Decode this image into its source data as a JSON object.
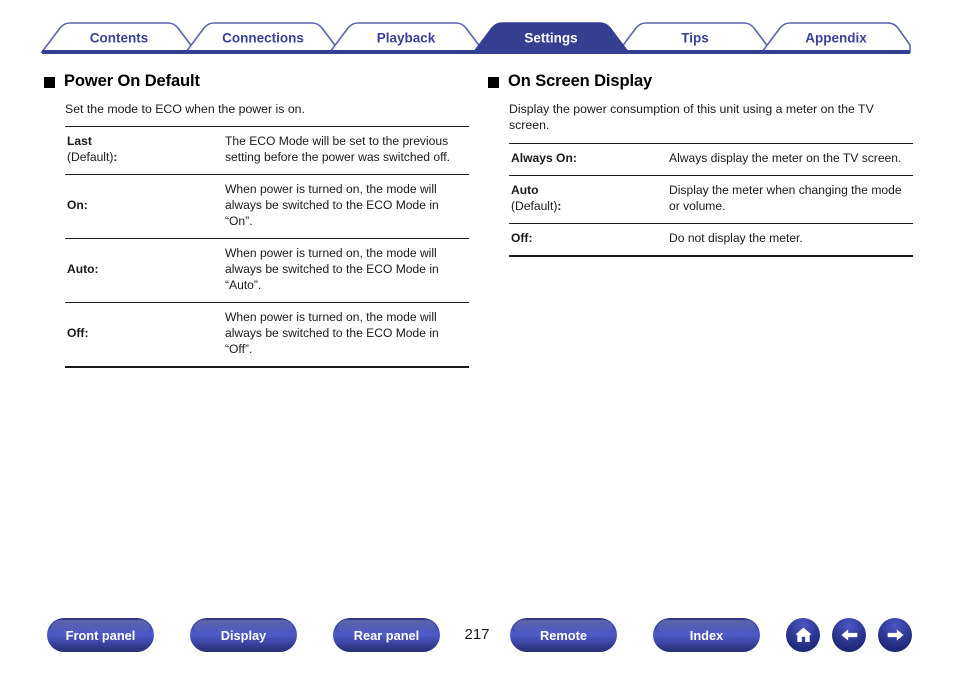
{
  "tabs": [
    {
      "label": "Contents",
      "active": false
    },
    {
      "label": "Connections",
      "active": false
    },
    {
      "label": "Playback",
      "active": false
    },
    {
      "label": "Settings",
      "active": true
    },
    {
      "label": "Tips",
      "active": false
    },
    {
      "label": "Appendix",
      "active": false
    }
  ],
  "colors": {
    "tab_border": "#5c63ab",
    "tab_text": "#3b4298",
    "tab_active_bg": "#353f92",
    "tab_active_text": "#ffffff",
    "rule": "#353f92",
    "button_blue": "#3b46a8",
    "body_text": "#1a1a1a"
  },
  "sections": {
    "left": {
      "heading": "Power On Default",
      "intro": "Set the mode to ECO when the power is on.",
      "rows": [
        {
          "term": "Last",
          "term_sub": "(Default)",
          "desc": "The ECO Mode will be set to the previous setting before the power was switched off."
        },
        {
          "term": "On",
          "term_sub": "",
          "desc": "When power is turned on, the mode will always be switched to the ECO Mode in “On”."
        },
        {
          "term": "Auto",
          "term_sub": "",
          "desc": "When power is turned on, the mode will always be switched to the ECO Mode in “Auto”."
        },
        {
          "term": "Off",
          "term_sub": "",
          "desc": "When power is turned on, the mode will always be switched to the ECO Mode in “Off”."
        }
      ]
    },
    "right": {
      "heading": "On Screen Display",
      "intro": "Display the power consumption of this unit using a meter on the TV screen.",
      "rows": [
        {
          "term": "Always On",
          "term_sub": "",
          "desc": "Always display the meter on the TV screen."
        },
        {
          "term": "Auto",
          "term_sub": "(Default)",
          "desc": "Display the meter when changing the mode or volume."
        },
        {
          "term": "Off",
          "term_sub": "",
          "desc": "Do not display the meter."
        }
      ]
    }
  },
  "bottom_nav": {
    "buttons": [
      {
        "label": "Front panel"
      },
      {
        "label": "Display"
      },
      {
        "label": "Rear panel"
      },
      {
        "label": "Remote"
      },
      {
        "label": "Index"
      }
    ],
    "page_number": "217",
    "icons": [
      {
        "name": "home-icon"
      },
      {
        "name": "arrow-left-icon"
      },
      {
        "name": "arrow-right-icon"
      }
    ]
  }
}
